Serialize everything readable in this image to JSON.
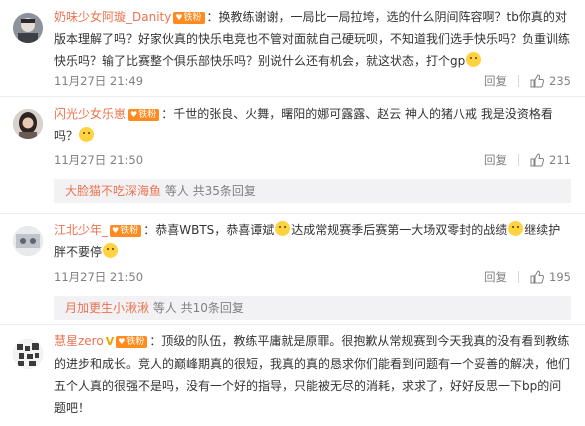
{
  "comments": [
    {
      "username": "奶味少女阿璇_Danity",
      "fan_badge": "铁粉",
      "text": "换教练谢谢，一局比一局拉垮，选的什么阴间阵容啊？tb你真的对版本理解了吗？好家伙真的快乐电竞也不管对面就自己硬玩呗，不知道我们选手快乐吗？负重训练快乐吗？输了比赛整个俱乐部快乐吗？别说什么还有机会，就这状态，打个gp",
      "time": "11月27日 21:49",
      "reply_label": "回复",
      "likes": "235"
    },
    {
      "username": "闪光少女乐崽",
      "fan_badge": "铁粉",
      "text": "千世的张良、火舞，曙阳的娜可露露、赵云    神人的猪八戒 我是没资格看吗？",
      "time": "11月27日 21:50",
      "reply_label": "回复",
      "likes": "211",
      "sub_user": "大脸猫不吃深海鱼",
      "sub_text": "等人 共35条回复"
    },
    {
      "username": "江北少年_",
      "fan_badge": "铁粉",
      "text_a": "恭喜WBTS，恭喜谭斌",
      "text_b": "达成常规赛季后赛第一大场双零封的战绩",
      "text_c": "继续护胖不要停",
      "time": "11月27日 21:50",
      "reply_label": "回复",
      "likes": "195",
      "sub_user": "月加更生小湫湫",
      "sub_text": "等人 共10条回复"
    },
    {
      "username": "慧星zero",
      "verify": "V",
      "fan_badge": "铁粉",
      "text": "顶级的队伍，教练平庸就是原罪。很抱歉从常规赛到今天我真的没有看到教练的进步和成长。竞人的巅峰期真的很短，我真的真的恳求你们能看到问题有一个妥善的解决，他们五个人真的很强不是吗，没有一个好的指导，只能被无尽的消耗，求求了，好好反思一下bp的问题吧！"
    }
  ],
  "colors": {
    "accent": "#eb7350",
    "fan_badge": "#ff8a1d",
    "meta": "#808080"
  }
}
